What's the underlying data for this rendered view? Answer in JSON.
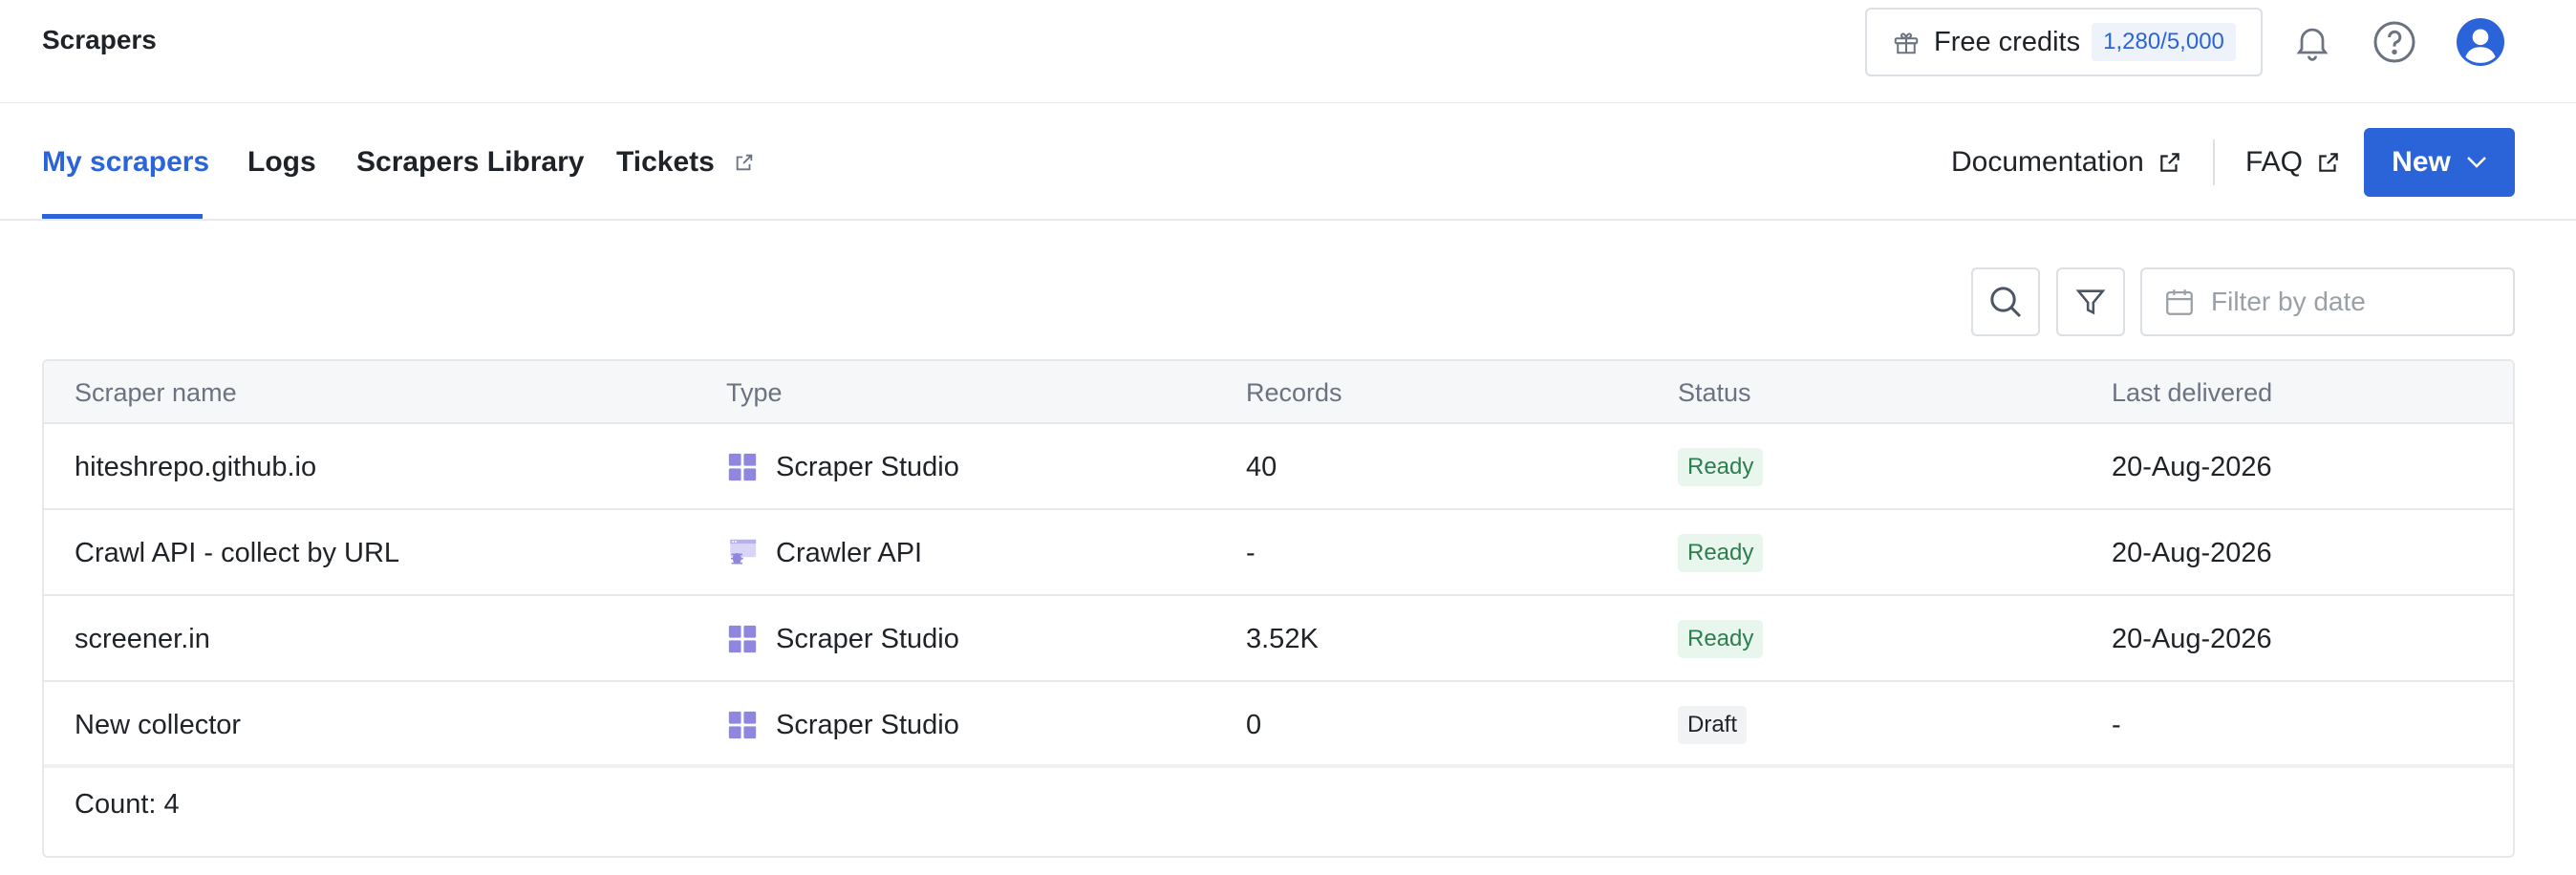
{
  "header": {
    "title": "Scrapers",
    "credits_label": "Free credits",
    "credits_value": "1,280/5,000",
    "icons": [
      "gift-icon",
      "bell-icon",
      "help-icon",
      "user-avatar-icon"
    ]
  },
  "tabs": {
    "items": [
      {
        "label": "My scrapers",
        "active": true
      },
      {
        "label": "Logs",
        "active": false
      },
      {
        "label": "Scrapers Library",
        "active": false
      },
      {
        "label": "Tickets",
        "active": false,
        "external": true
      }
    ],
    "documentation": "Documentation",
    "faq": "FAQ",
    "new_button": "New"
  },
  "toolbar": {
    "date_placeholder": "Filter by date"
  },
  "table": {
    "columns": [
      "Scraper name",
      "Type",
      "Records",
      "Status",
      "Last delivered"
    ],
    "rows": [
      {
        "name": "hiteshrepo.github.io",
        "type": "Scraper Studio",
        "type_icon": "grid-icon",
        "records": "40",
        "status": "Ready",
        "last_delivered": "20-Aug-2026"
      },
      {
        "name": "Crawl API - collect by URL",
        "type": "Crawler API",
        "type_icon": "crawler-icon",
        "records": "-",
        "status": "Ready",
        "last_delivered": "20-Aug-2026"
      },
      {
        "name": "screener.in",
        "type": "Scraper Studio",
        "type_icon": "grid-icon",
        "records": "3.52K",
        "status": "Ready",
        "last_delivered": "20-Aug-2026"
      },
      {
        "name": "New collector",
        "type": "Scraper Studio",
        "type_icon": "grid-icon",
        "records": "0",
        "status": "Draft",
        "last_delivered": "-"
      }
    ],
    "count_label": "Count: 4"
  },
  "colors": {
    "accent": "#2b64d8",
    "ready_bg": "#e8f6ee",
    "ready_text": "#2e7d4f",
    "draft_bg": "#f1f2f4",
    "icon_purple": "#8f86e0"
  }
}
